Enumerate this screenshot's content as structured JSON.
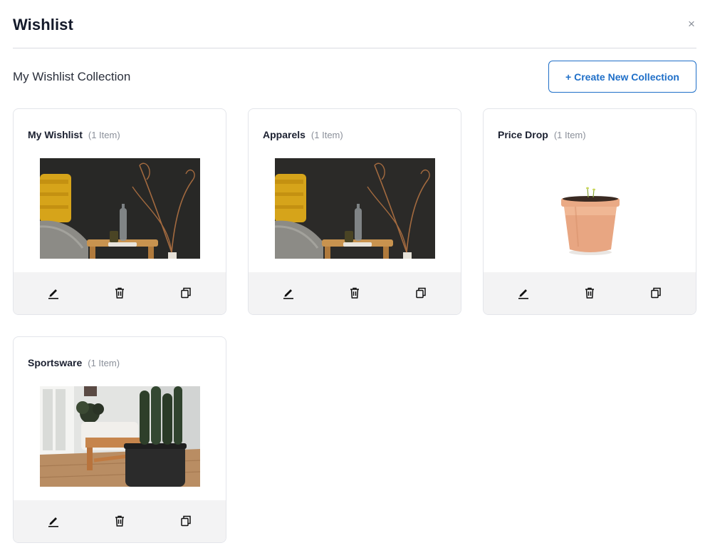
{
  "modal": {
    "title": "Wishlist",
    "close_label": "×"
  },
  "collection_heading": "My Wishlist Collection",
  "create_button_label": "+ Create New Collection",
  "collections": [
    {
      "name": "My Wishlist",
      "count": "(1 Item)",
      "image": "bedroom-nightstand-image"
    },
    {
      "name": "Apparels",
      "count": "(1 Item)",
      "image": "bedroom-nightstand-image"
    },
    {
      "name": "Price Drop",
      "count": "(1 Item)",
      "image": "terracotta-pot-image"
    },
    {
      "name": "Sportsware",
      "count": "(1 Item)",
      "image": "living-room-cactus-image"
    }
  ],
  "actions": {
    "edit": "pencil-icon",
    "delete": "trash-icon",
    "copy": "copy-icon"
  }
}
